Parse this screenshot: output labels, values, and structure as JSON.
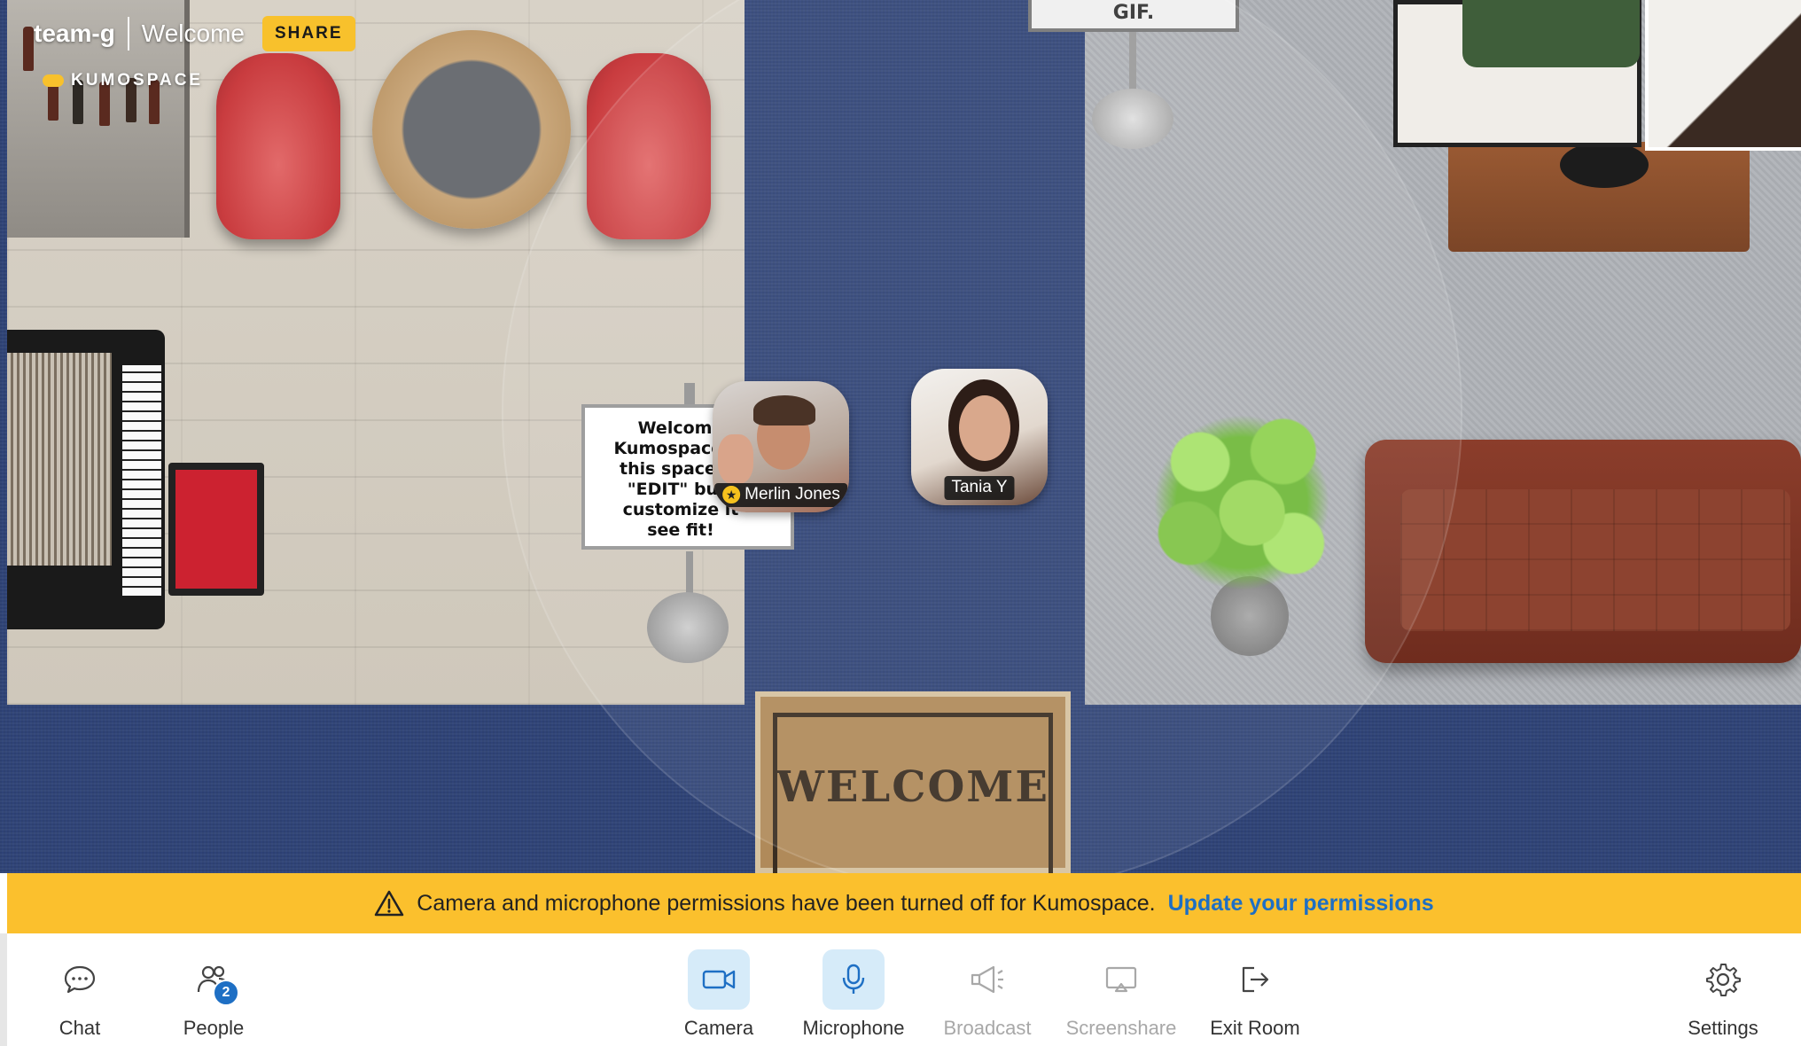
{
  "header": {
    "room_name": "team-g",
    "room_title": "Welcome",
    "share_label": "SHARE",
    "brand_name": "KUMOSPACE"
  },
  "scene": {
    "sign_text": "Welcome\nKumospace! E\nthis space or\n\"EDIT\" butt\ncustomize it\nsee fit!",
    "gif_label": "GIF.",
    "mat_text": "WELCOME",
    "participants": [
      {
        "name": "Merlin Jones",
        "is_host": true
      },
      {
        "name": "Tania Y",
        "is_host": false
      }
    ]
  },
  "banner": {
    "message": "Camera and microphone permissions have been turned off for Kumospace.",
    "link_text": "Update your permissions"
  },
  "toolbar": {
    "chat_label": "Chat",
    "people_label": "People",
    "people_count": "2",
    "camera_label": "Camera",
    "microphone_label": "Microphone",
    "broadcast_label": "Broadcast",
    "screenshare_label": "Screenshare",
    "exit_label": "Exit Room",
    "settings_label": "Settings"
  },
  "colors": {
    "accent_yellow": "#f8c12c",
    "banner_yellow": "#fbc02d",
    "link_blue": "#1e6fc4",
    "active_tool_bg": "#d6ebf9",
    "carpet_blue": "#2f4377"
  }
}
